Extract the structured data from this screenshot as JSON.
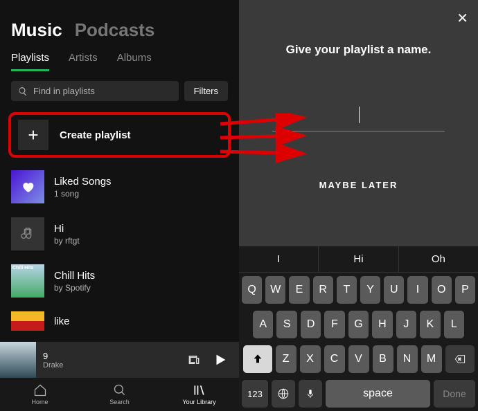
{
  "header": {
    "tabs": [
      "Music",
      "Podcasts"
    ],
    "activeTab": 0
  },
  "subTabs": {
    "items": [
      "Playlists",
      "Artists",
      "Albums"
    ],
    "active": 0
  },
  "search": {
    "placeholder": "Find in playlists",
    "filtersLabel": "Filters"
  },
  "createPlaylist": {
    "label": "Create playlist"
  },
  "playlists": [
    {
      "title": "Liked Songs",
      "subtitle": "1 song",
      "type": "liked"
    },
    {
      "title": "Hi",
      "subtitle": "by rftgt",
      "type": "music"
    },
    {
      "title": "Chill Hits",
      "subtitle": "by Spotify",
      "type": "chill"
    },
    {
      "title": "like",
      "subtitle": "",
      "type": "urban"
    }
  ],
  "nowPlaying": {
    "title": "9",
    "artist": "Drake"
  },
  "bottomNav": {
    "items": [
      "Home",
      "Search",
      "Your Library"
    ],
    "active": 2
  },
  "rightPanel": {
    "title": "Give your playlist a name.",
    "maybeLater": "MAYBE LATER",
    "suggestions": [
      "I",
      "Hi",
      "Oh"
    ],
    "keyboard": {
      "row1": [
        "Q",
        "W",
        "E",
        "R",
        "T",
        "Y",
        "U",
        "I",
        "O",
        "P"
      ],
      "row2": [
        "A",
        "S",
        "D",
        "F",
        "G",
        "H",
        "J",
        "K",
        "L"
      ],
      "row3": [
        "Z",
        "X",
        "C",
        "V",
        "B",
        "N",
        "M"
      ],
      "space": "space",
      "done": "Done",
      "num": "123"
    }
  }
}
